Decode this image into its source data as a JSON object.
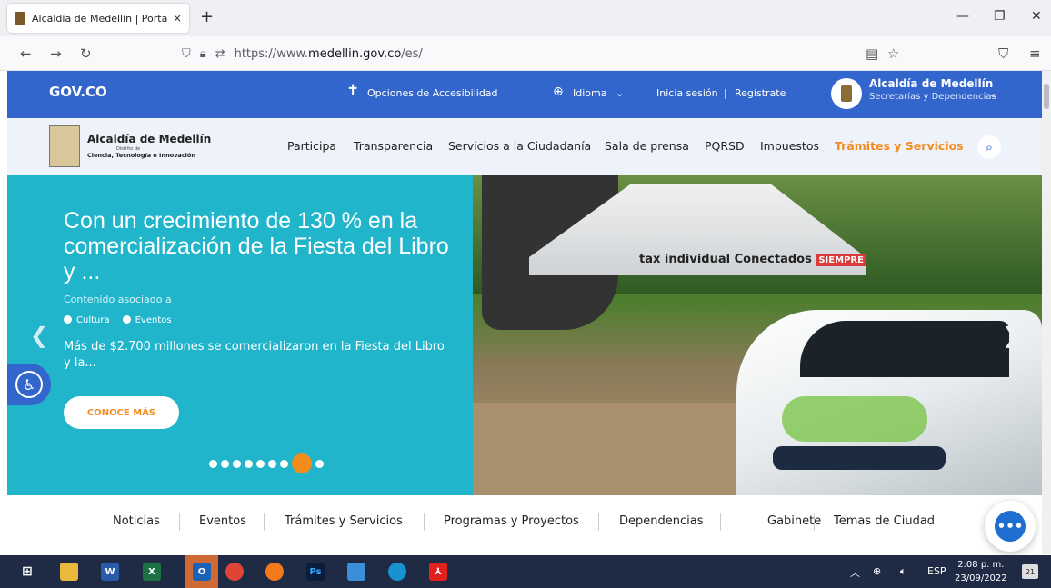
{
  "browser": {
    "tab_title": "Alcaldía de Medellín | Portal ins",
    "tab_close": "×",
    "new_tab": "+",
    "url_prefix": "https://www.",
    "url_domain": "medellin.gov.co",
    "url_path": "/es/",
    "window_buttons": [
      "—",
      "❐",
      "✕"
    ]
  },
  "gov_bar": {
    "logo": "GOV.CO",
    "accessibility": "Opciones de Accesibilidad",
    "language": "Idioma",
    "login": "Inicia sesión",
    "divider": "|",
    "register": "Regístrate",
    "org_name": "Alcaldía de Medellín",
    "org_sub": "Secretarías y Dependencias"
  },
  "main_nav": {
    "brand": "Alcaldía de Medellín",
    "brand_sub1": "Distrito de",
    "brand_sub2": "Ciencia, Tecnología e Innovación",
    "links": [
      "Participa",
      "Transparencia",
      "Servicios a la Ciudadanía",
      "Sala de prensa",
      "PQRSD",
      "Impuestos",
      "Trámites y Servicios"
    ]
  },
  "hero": {
    "title": "Con un crecimiento de 130 % en la comercialización de la Fiesta del Libro y ...",
    "associated": "Contenido asociado a",
    "tags": [
      "Cultura",
      "Eventos"
    ],
    "summary": "Más de $2.700 millones se comercializaron en la Fiesta del Libro y la...",
    "cta": "CONOCE MÁS",
    "slide_count": 9,
    "active_slide": 8,
    "photo_banner": "tax individual Conectados",
    "photo_banner_tag": "SIEMPRE"
  },
  "section_nav": [
    "Noticias",
    "Eventos",
    "Trámites y Servicios",
    "Programas y Proyectos",
    "Dependencias",
    "Gabinete",
    "Temas de Ciudad"
  ],
  "taskbar": {
    "language": "ESP",
    "time": "2:08 p. m.",
    "date": "23/09/2022",
    "notifications": "21"
  },
  "colors": {
    "gov_blue": "#3366cc",
    "hero_teal": "#20b5cb",
    "accent_orange": "#f38b1d"
  }
}
